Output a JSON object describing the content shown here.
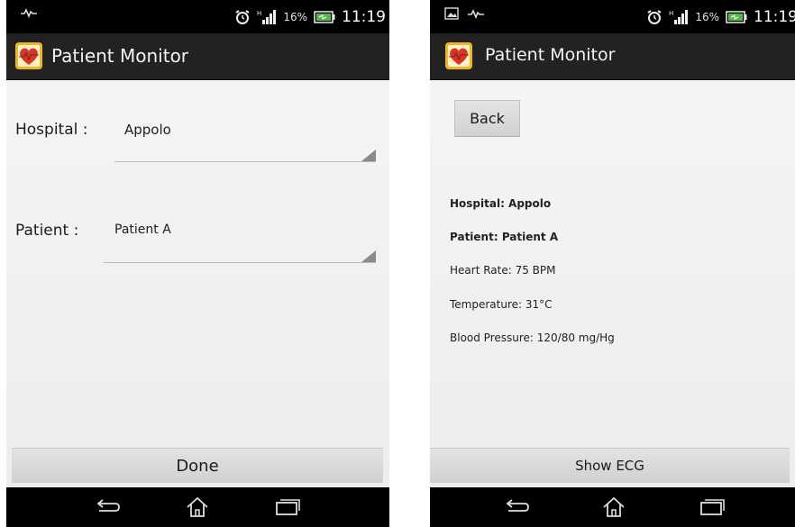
{
  "status_bar": {
    "battery_text": "16%",
    "clock_left": "11:19",
    "clock_right": "11:19"
  },
  "app": {
    "title": "Patient Monitor"
  },
  "selection_screen": {
    "hospital_label": "Hospital :",
    "hospital_value": "Appolo",
    "patient_label": "Patient :",
    "patient_value": "Patient A",
    "done_label": "Done"
  },
  "details_screen": {
    "back_label": "Back",
    "hospital_line": "Hospital: Appolo",
    "patient_line": "Patient: Patient A",
    "heart_rate_line": "Heart Rate: 75 BPM",
    "temperature_line": "Temperature: 31°C",
    "blood_pressure_line": "Blood Pressure: 120/80 mg/Hg",
    "show_ecg_label": "Show ECG"
  },
  "icons": {
    "app_logo": "heart-logo-icon",
    "nav_back": "back-icon",
    "nav_home": "home-icon",
    "nav_recents": "recents-icon",
    "notification": "pulse-icon",
    "screenshot": "image-icon",
    "alarm": "alarm-icon",
    "signal": "signal-icon",
    "battery": "battery-icon"
  },
  "colors": {
    "action_bar": "#222222",
    "status_bar": "#000000",
    "button": "#d8d8d8",
    "logo_heart": "#d8342c",
    "logo_frame": "#f0b429"
  }
}
